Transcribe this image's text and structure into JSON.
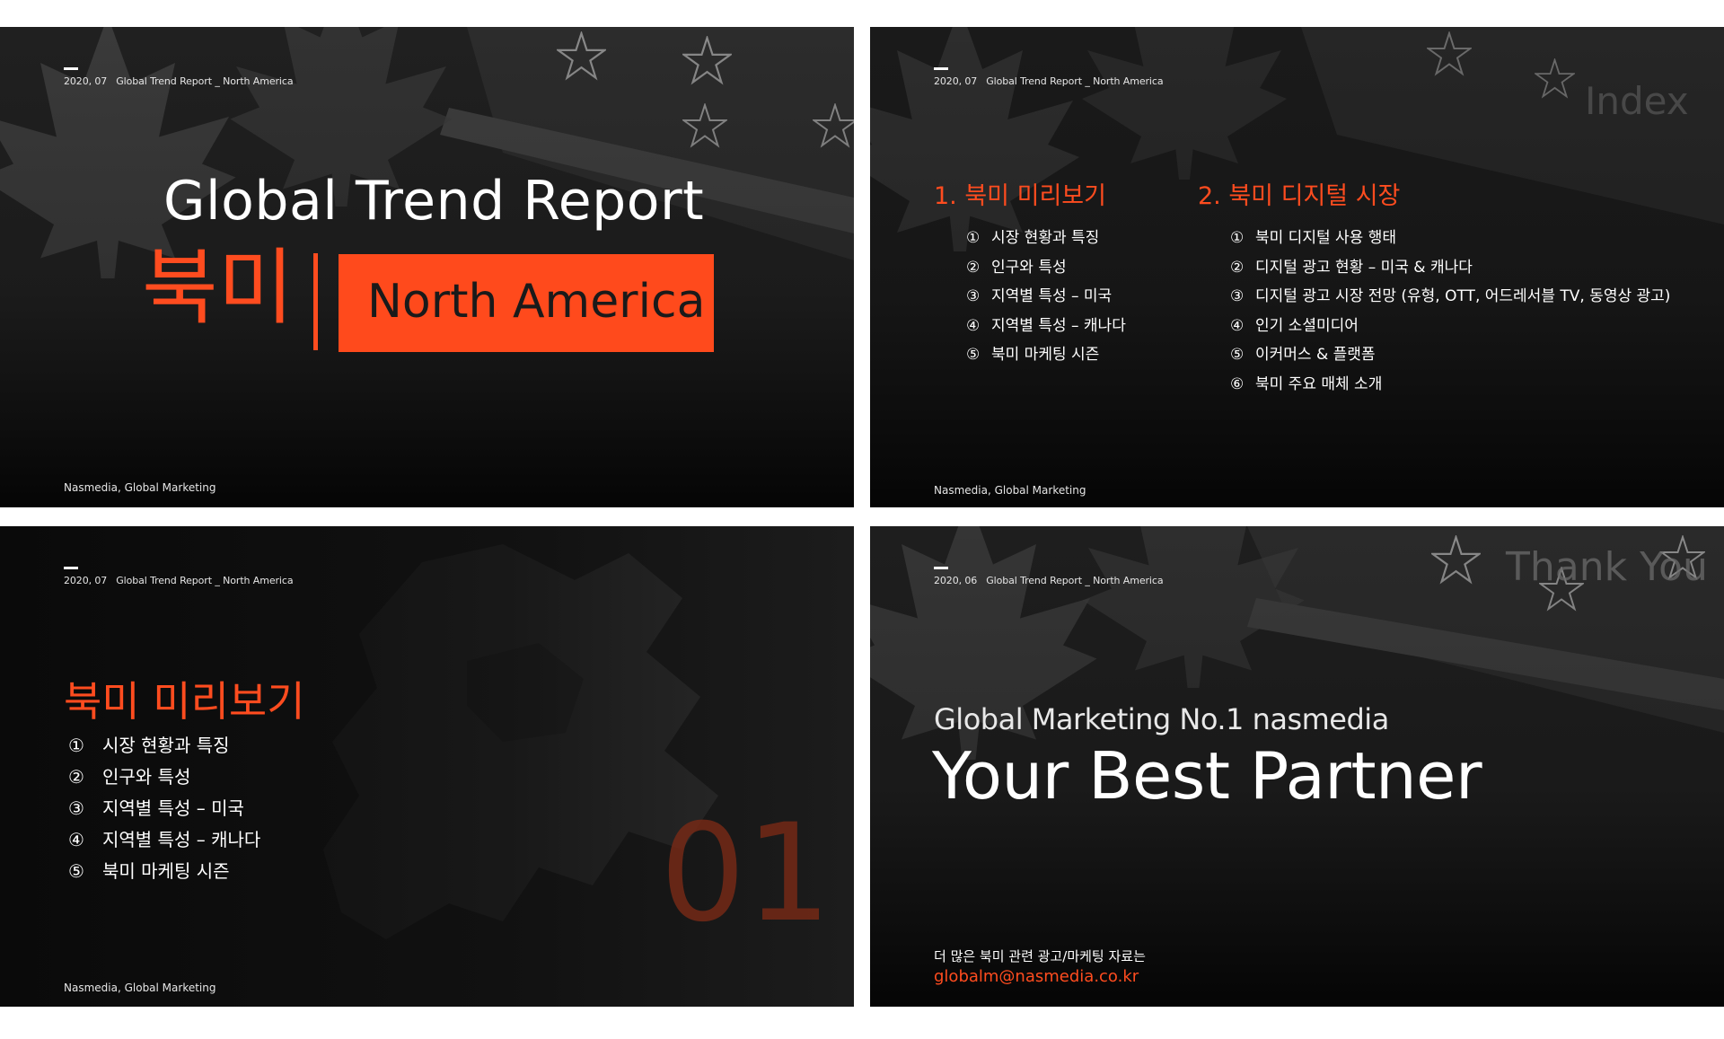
{
  "colors": {
    "accent": "#ff4c1f",
    "background": "#080808",
    "text": "#ffffff"
  },
  "slide1": {
    "header": {
      "date": "2020, 07",
      "title": "Global Trend Report _ North America"
    },
    "title": "Global Trend Report",
    "korean_title": "북미",
    "box_label": "North America",
    "footer": "Nasmedia, Global Marketing"
  },
  "slide2": {
    "header": {
      "date": "2020, 07",
      "title": "Global Trend Report _ North America"
    },
    "watermark": "Index",
    "sections": [
      {
        "title": "1. 북미 미리보기",
        "items": [
          {
            "num": "①",
            "label": "시장 현황과 특징"
          },
          {
            "num": "②",
            "label": "인구와 특성"
          },
          {
            "num": "③",
            "label": "지역별 특성 – 미국"
          },
          {
            "num": "④",
            "label": "지역별 특성 – 캐나다"
          },
          {
            "num": "⑤",
            "label": "북미 마케팅 시즌"
          }
        ]
      },
      {
        "title": "2. 북미 디지털 시장",
        "items": [
          {
            "num": "①",
            "label": "북미 디지털 사용 행태"
          },
          {
            "num": "②",
            "label": "디지털 광고 현황 – 미국 & 캐나다"
          },
          {
            "num": "③",
            "label": "디지털 광고 시장 전망 (유형, OTT, 어드레서블 TV, 동영상 광고)"
          },
          {
            "num": "④",
            "label": "인기 소셜미디어"
          },
          {
            "num": "⑤",
            "label": "이커머스 & 플랫폼"
          },
          {
            "num": "⑥",
            "label": "북미 주요 매체 소개"
          }
        ]
      }
    ],
    "footer": "Nasmedia, Global Marketing"
  },
  "slide3": {
    "header": {
      "date": "2020, 07",
      "title": "Global Trend Report _ North America"
    },
    "title": "북미 미리보기",
    "items": [
      {
        "num": "①",
        "label": "시장 현황과 특징"
      },
      {
        "num": "②",
        "label": "인구와 특성"
      },
      {
        "num": "③",
        "label": "지역별 특성 – 미국"
      },
      {
        "num": "④",
        "label": "지역별 특성 – 캐나다"
      },
      {
        "num": "⑤",
        "label": "북미 마케팅 시즌"
      }
    ],
    "section_number": "01",
    "footer": "Nasmedia, Global Marketing"
  },
  "slide4": {
    "header": {
      "date": "2020, 06",
      "title": "Global Trend Report _ North America"
    },
    "watermark": "Thank You",
    "subtitle": "Global Marketing No.1 nasmedia",
    "main": "Your Best Partner",
    "note": "더 많은 북미 관련 광고/마케팅 자료는",
    "email": "globalm@nasmedia.co.kr"
  },
  "icons": [
    "maple-leaf-icon",
    "star-icon",
    "north-america-map-icon"
  ]
}
